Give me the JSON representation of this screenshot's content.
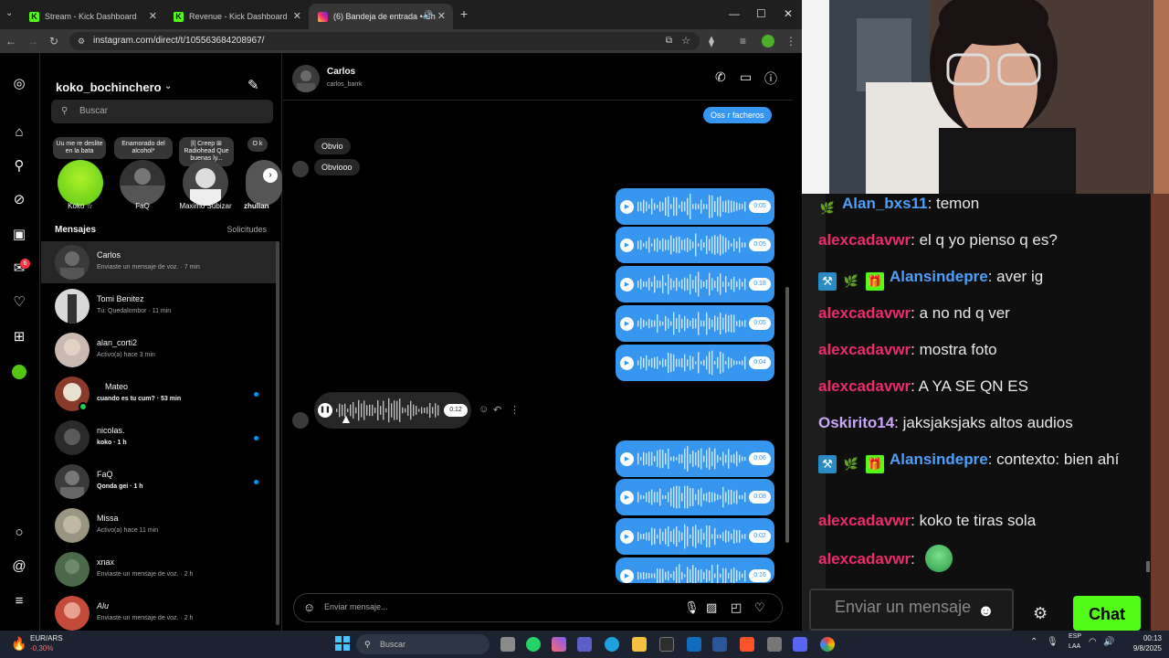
{
  "browser": {
    "tabs": [
      {
        "title": "Stream - Kick Dashboard"
      },
      {
        "title": "Revenue - Kick Dashboard"
      },
      {
        "title": "(6) Bandeja de entrada • Ch"
      }
    ],
    "url": "instagram.com/direct/t/105563684208967/"
  },
  "sidebar": {
    "notifications_badge": "6"
  },
  "dm_list": {
    "username": "koko_bochinchero",
    "search_placeholder": "Buscar",
    "notes": [
      "Uu me re deslite en la bata",
      "Enamorado del alcohol*",
      "|l| Creep ⊞ Radiohead Que buenas ly...",
      "O k"
    ],
    "stories": [
      "Koko ☆",
      "FaQ",
      "Maximo Subizar",
      "zhulian"
    ],
    "messages_header": "Mensajes",
    "requests_label": "Solicitudes",
    "conversations": [
      {
        "name": "Carlos",
        "preview": "Enviaste un mensaje de voz. · 7 min"
      },
      {
        "name": "Tomi Benitez",
        "preview": "Tú: Quedalombor · 11 min"
      },
      {
        "name": "alan_corti2",
        "preview": "Activo(a) hace 3 min"
      },
      {
        "name": "Mateo",
        "preview": "cuando es tu cum? · 53 min"
      },
      {
        "name": "nicolas.",
        "preview": "koko · 1 h"
      },
      {
        "name": "FaQ",
        "preview": "Qonda gei · 1 h"
      },
      {
        "name": "Missa",
        "preview": "Activo(a) hace 11 min"
      },
      {
        "name": "xnax",
        "preview": "Enviaste un mensaje de voz. · 2 h"
      },
      {
        "name": "Alu",
        "preview": "Enviaste un mensaje de voz. · 2 h"
      }
    ]
  },
  "chat": {
    "contact_name": "Carlos",
    "contact_handle": "carlos_barrk",
    "msg_out_top": "Oss r facheros",
    "msg_in_1": "Obvio",
    "msg_in_2": "Obviooo",
    "voice_out_group1": [
      "0:05",
      "0:05",
      "0:18",
      "0:05",
      "0:04"
    ],
    "voice_in": "0:12",
    "voice_out_group2": [
      "0:06",
      "0:08",
      "0:02",
      "0:16"
    ],
    "composer_placeholder": "Enviar mensaje..."
  },
  "kick_chat": {
    "lines": [
      {
        "user": "Alan_bxs11",
        "text": ": temon"
      },
      {
        "user": "alexcadavwr",
        "text": ": el q yo pienso q es?"
      },
      {
        "user": "Alansindepre",
        "text": ": aver ig"
      },
      {
        "user": "alexcadavwr",
        "text": ": a no nd q ver"
      },
      {
        "user": "alexcadavwr",
        "text": ": mostra foto"
      },
      {
        "user": "alexcadavwr",
        "text": ": A YA SE QN ES"
      },
      {
        "user": "Oskirito14",
        "text": ": jaksjaksjaks altos audios"
      },
      {
        "user": "Alansindepre",
        "text": ": contexto: bien ahí"
      },
      {
        "user": "alexcadavwr",
        "text": ": koko te tiras sola"
      },
      {
        "user": "alexcadavwr",
        "text": ":"
      }
    ],
    "input_placeholder": "Enviar un mensaje",
    "chat_button": "Chat",
    "colors": {
      "pink": "#ec2b6b",
      "blue": "#4d9ff7",
      "lilac": "#c9a6f5",
      "kick_green": "#53fc18"
    }
  },
  "taskbar": {
    "weather_top": "EUR/ARS",
    "weather_bottom": "-0,30%",
    "search_placeholder": "Buscar",
    "lang_top": "ESP",
    "lang_bottom": "LAA",
    "time": "00:13",
    "date": "9/8/2025"
  }
}
